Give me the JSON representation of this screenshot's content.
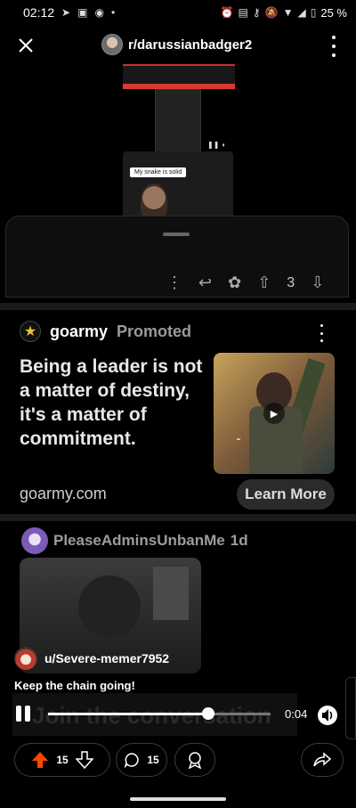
{
  "status_bar": {
    "time": "02:12",
    "battery": "25 %"
  },
  "header": {
    "subreddit": "r/darussianbadger2"
  },
  "video_preview": {
    "label": "My snake is solid"
  },
  "comment_sheet": {
    "vote_count": "3"
  },
  "ad": {
    "brand": "goarmy",
    "promoted_label": "Promoted",
    "headline": "Being a leader is not a matter of destiny, it's a matter of commitment.",
    "domain": "goarmy.com",
    "cta_label": "Learn More"
  },
  "next_post": {
    "username": "PleaseAdminsUnbanMe",
    "age": "1d"
  },
  "video_overlay": {
    "username": "u/Severe-memer7952",
    "caption": "Keep the chain going!",
    "background_text": "Join the conversation",
    "time": "0:04",
    "progress_fraction": 0.72
  },
  "action_bar": {
    "upvotes": "15",
    "comments": "15"
  },
  "colors": {
    "upvote_active": "#ff4500",
    "ad_star": "#e5c23a"
  }
}
